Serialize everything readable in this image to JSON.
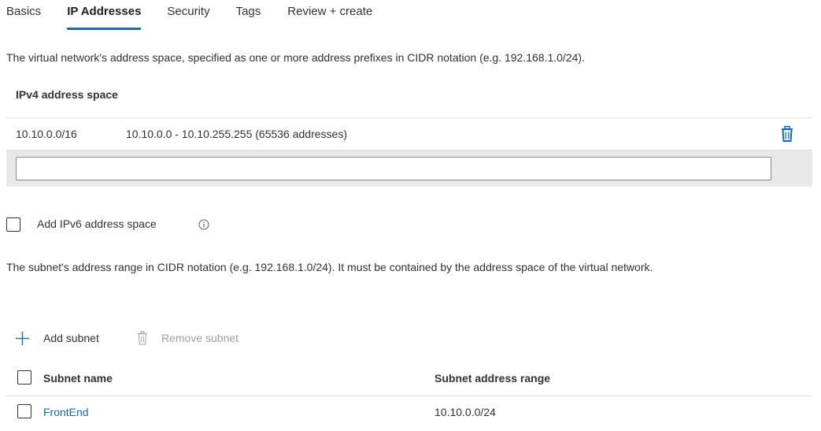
{
  "tabs": [
    {
      "label": "Basics",
      "active": false
    },
    {
      "label": "IP Addresses",
      "active": true
    },
    {
      "label": "Security",
      "active": false
    },
    {
      "label": "Tags",
      "active": false
    },
    {
      "label": "Review + create",
      "active": false
    }
  ],
  "address_space": {
    "description": "The virtual network's address space, specified as one or more address prefixes in CIDR notation (e.g. 192.168.1.0/24).",
    "header": "IPv4 address space",
    "rows": [
      {
        "prefix": "10.10.0.0/16",
        "range": "10.10.0.0 - 10.10.255.255 (65536 addresses)"
      }
    ],
    "new_input": {
      "value": "",
      "placeholder": ""
    }
  },
  "ipv6": {
    "label": "Add IPv6 address space",
    "checked": false
  },
  "subnets": {
    "description": "The subnet's address range in CIDR notation (e.g. 192.168.1.0/24). It must be contained by the address space of the virtual network.",
    "add_label": "Add subnet",
    "remove_label": "Remove subnet",
    "columns": [
      "Subnet name",
      "Subnet address range"
    ],
    "rows": [
      {
        "name": "FrontEnd",
        "range": "10.10.0.0/24",
        "checked": false
      }
    ]
  },
  "colors": {
    "accent": "#0f6cbd",
    "text": "#323130",
    "disabled": "#a19f9d"
  },
  "icons": {
    "delete": "trash-icon",
    "info": "info-icon",
    "add": "plus-icon",
    "remove": "trash-icon"
  }
}
